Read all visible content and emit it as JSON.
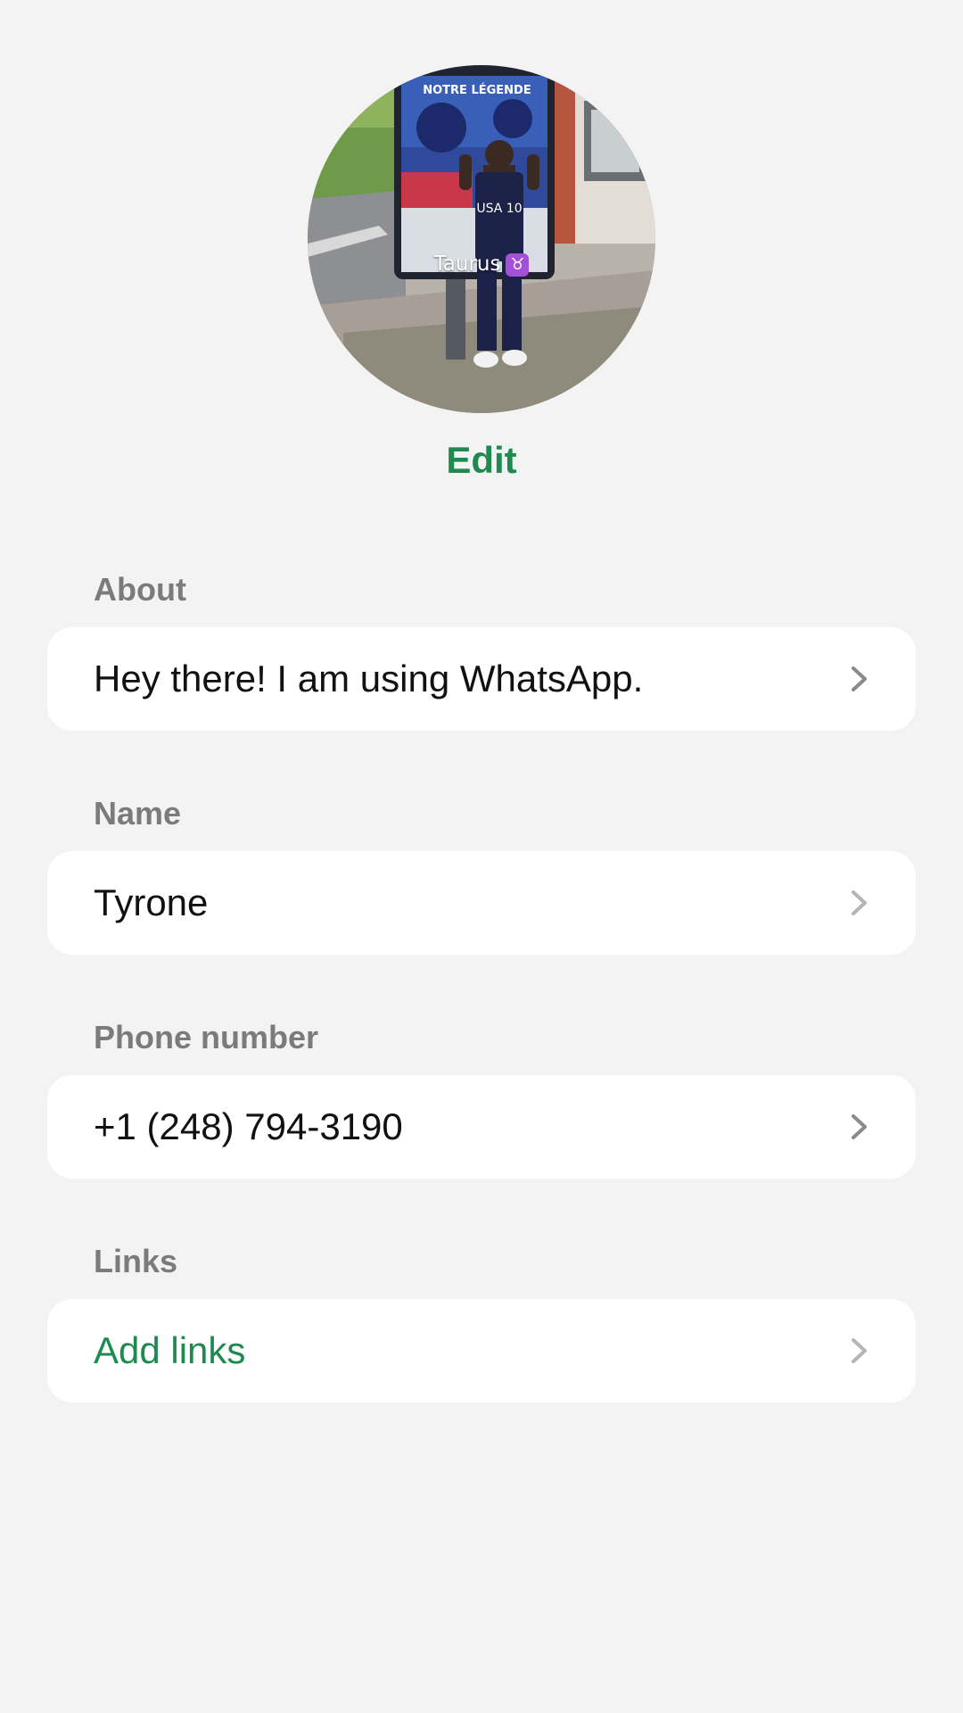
{
  "avatar": {
    "caption": "Taurus",
    "caption_emoji": "♉",
    "poster_text": "NOTRE LÉGENDE",
    "shirt_text": "USA 10"
  },
  "profile": {
    "edit_label": "Edit"
  },
  "sections": {
    "about": {
      "label": "About",
      "value": "Hey there! I am using WhatsApp."
    },
    "name": {
      "label": "Name",
      "value": "Tyrone"
    },
    "phone": {
      "label": "Phone number",
      "value": "+1 (248) 794-3190"
    },
    "links": {
      "label": "Links",
      "value": "Add links"
    }
  },
  "colors": {
    "accent_green": "#1e8a4f",
    "background": "#f3f3f3",
    "card": "#ffffff",
    "label_gray": "#7b7b7b"
  },
  "icons": {
    "row_chevron": "chevron-right-icon"
  }
}
